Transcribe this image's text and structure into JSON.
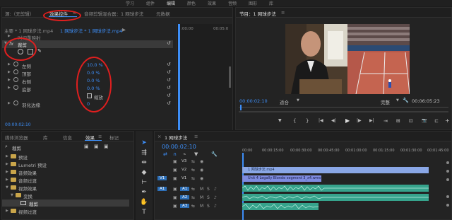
{
  "workspaces": [
    "学习",
    "组件",
    "编辑",
    "颜色",
    "效果",
    "音频",
    "图形",
    "库"
  ],
  "effect_controls": {
    "tab_source": "源:（无剪辑）",
    "tab_effects": "效果控件",
    "tab_menu": "≡",
    "tab_audio_mixer": "音频剪辑混合器：1 网球步法",
    "tab_metadata": "元数据",
    "master_clip": "主要 * 1 网球步法.mp4",
    "sequence_clip": "1 网球步法 * 1 网球步法.mp4",
    "timecode_start": ":00:00",
    "timecode_end": "00:05:0",
    "time_remap": "时间重映射",
    "crop_section": "裁剪",
    "params": [
      {
        "label": "左侧",
        "value": "10.0 %"
      },
      {
        "label": "顶部",
        "value": "0.0 %"
      },
      {
        "label": "右侧",
        "value": "0.0 %"
      },
      {
        "label": "底部",
        "value": "0.0 %"
      },
      {
        "label": "",
        "value": ""
      },
      {
        "label": "羽化边缘",
        "value": "0"
      }
    ],
    "zoom_label": "缩放",
    "timecode": "00:00:02:10"
  },
  "program_monitor": {
    "title": "节目：1 网球步法",
    "menu": "≡",
    "timecode_current": "00:00:02:10",
    "fit": "适合",
    "quality": "完整",
    "timecode_total": "00:06:05:23",
    "controls": [
      "▼",
      "{",
      "}",
      "|◀",
      "◀|",
      "▶",
      "|▶",
      "▶|",
      "⇥",
      "⊞",
      "⊡",
      "📷",
      "⊏",
      "+"
    ]
  },
  "project": {
    "tabs": [
      "媒体浏览器",
      "库",
      "信息",
      "效果",
      "标记"
    ],
    "menu": "≡",
    "search_value": "裁剪",
    "items": [
      {
        "label": "预设",
        "indent": 0,
        "type": "folder"
      },
      {
        "label": "Lumetri 预设",
        "indent": 0,
        "type": "folder"
      },
      {
        "label": "音频效果",
        "indent": 0,
        "type": "folder"
      },
      {
        "label": "音频过渡",
        "indent": 0,
        "type": "folder"
      },
      {
        "label": "视频效果",
        "indent": 0,
        "type": "folder"
      },
      {
        "label": "变换",
        "indent": 1,
        "type": "folder"
      },
      {
        "label": "裁剪",
        "indent": 2,
        "type": "effect"
      },
      {
        "label": "视频过渡",
        "indent": 0,
        "type": "folder"
      }
    ]
  },
  "timeline": {
    "tab": "1 网球步法",
    "menu": "≡",
    "timecode": "00:00:02:10",
    "ruler": [
      "00:00",
      "00:00:15:00",
      "00:00:30:00",
      "00:00:45:00",
      "00:01:00:00",
      "00:01:15:00",
      "00:01:30:00",
      "00:01:45:00"
    ],
    "tracks": [
      {
        "name": "V3",
        "kind": "video"
      },
      {
        "name": "V2",
        "kind": "video"
      },
      {
        "name": "V1",
        "kind": "video",
        "source": "V1"
      },
      {
        "name": "A1",
        "kind": "audio",
        "source": "A1"
      },
      {
        "name": "A2",
        "kind": "audio"
      },
      {
        "name": "A3",
        "kind": "audio"
      }
    ],
    "clip_v2": "1 网球步法.mp4",
    "clip_v1": "Unit 4 Legally Blonde segment 3_x4.wmv [V]",
    "track_icons": {
      "lock": "🔒",
      "eye": "👁",
      "mute": "M",
      "solo": "S",
      "mic": "🎤"
    }
  },
  "colors": {
    "accent": "#3d8ef7",
    "clip_video": "#8aa7e6",
    "clip_v1": "#7e8be0",
    "clip_audio": "#36a38c",
    "annotation": "#e01f1f"
  }
}
